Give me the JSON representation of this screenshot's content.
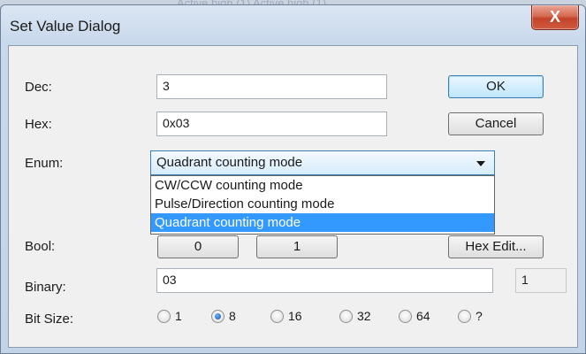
{
  "backdrop": {
    "ghost_text": "Active high (1)  Active high (1)"
  },
  "window": {
    "title": "Set Value Dialog",
    "close_glyph": "X"
  },
  "fields": {
    "dec": {
      "label": "Dec:",
      "value": "3"
    },
    "hex": {
      "label": "Hex:",
      "value": "0x03"
    },
    "enum": {
      "label": "Enum:",
      "value": "Quadrant counting mode",
      "options": [
        "CW/CCW counting mode",
        "Pulse/Direction counting mode",
        "Quadrant counting mode"
      ],
      "selected_index": 2
    },
    "bool": {
      "label": "Bool:",
      "false_label": "0",
      "true_label": "1"
    },
    "binary": {
      "label": "Binary:",
      "value": "03",
      "count": "1"
    },
    "bitsize": {
      "label": "Bit Size:",
      "options": [
        "1",
        "8",
        "16",
        "32",
        "64",
        "?"
      ],
      "selected_index": 1
    }
  },
  "buttons": {
    "ok": "OK",
    "cancel": "Cancel",
    "hex_edit": "Hex Edit..."
  },
  "colors": {
    "selection": "#3399ff",
    "accent": "#3c7fb1",
    "close": "#c3432a"
  }
}
